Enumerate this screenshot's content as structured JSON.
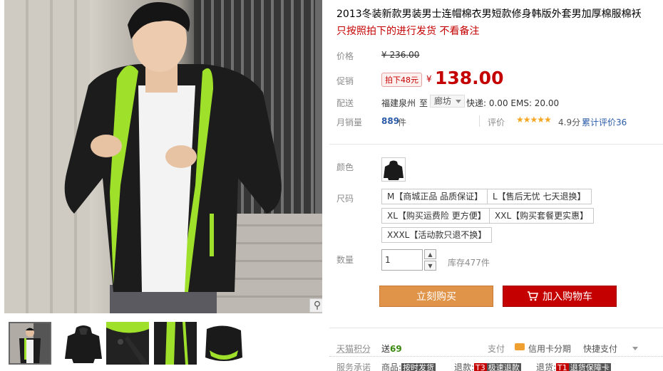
{
  "product": {
    "title": "2013冬装新款男装男士连帽棉衣男短款修身韩版外套男加厚棉服棉袄",
    "subtitle": "只按照拍下的进行发货 不看备注"
  },
  "price": {
    "label": "价格",
    "original": "¥ 236.00",
    "promo_label": "促销",
    "badge": "拍下48元",
    "currency": "¥",
    "promo_price": "138.00"
  },
  "shipping": {
    "label": "配送",
    "from": "福建泉州",
    "to_word": "至",
    "destination": "廊坊",
    "fees": "快递: 0.00 EMS: 20.00"
  },
  "sales": {
    "label": "月销量",
    "count": "889",
    "unit": "件",
    "rating_label": "评价",
    "stars": "★★★★★",
    "score": "4.9分",
    "reviews": "累计评价36"
  },
  "color": {
    "label": "颜色"
  },
  "size": {
    "label": "尺码",
    "options": [
      "M【商城正品 品质保证】",
      "L【售后无忧 七天退换】",
      "XL【购买运费险 更方便】",
      "XXL【购买套餐更实惠】",
      "XXXL【活动款只退不换】"
    ]
  },
  "quantity": {
    "label": "数量",
    "value": "1",
    "up": "▲",
    "down": "▼",
    "stock": "库存477件"
  },
  "buttons": {
    "buy_now": "立刻购买",
    "add_cart": "加入购物车",
    "cart_glyph": "🛒"
  },
  "points": {
    "label": "天猫积分",
    "prefix": "送",
    "value": "69",
    "pay_label": "支付",
    "credit": "信用卡分期",
    "quick": "快捷支付"
  },
  "promise": {
    "label": "服务承诺",
    "items": [
      {
        "prefix": "商品:",
        "tag": "按时发货"
      },
      {
        "prefix": "退款:",
        "code": "T3",
        "tag": "极速退款"
      },
      {
        "prefix": "退货:",
        "code": "T1",
        "tag": "退货保障卡"
      }
    ]
  },
  "colors": {
    "accent": "#c40000",
    "buy": "#e0944a",
    "link": "#2b5ba8",
    "lime": "#9ee02a"
  }
}
